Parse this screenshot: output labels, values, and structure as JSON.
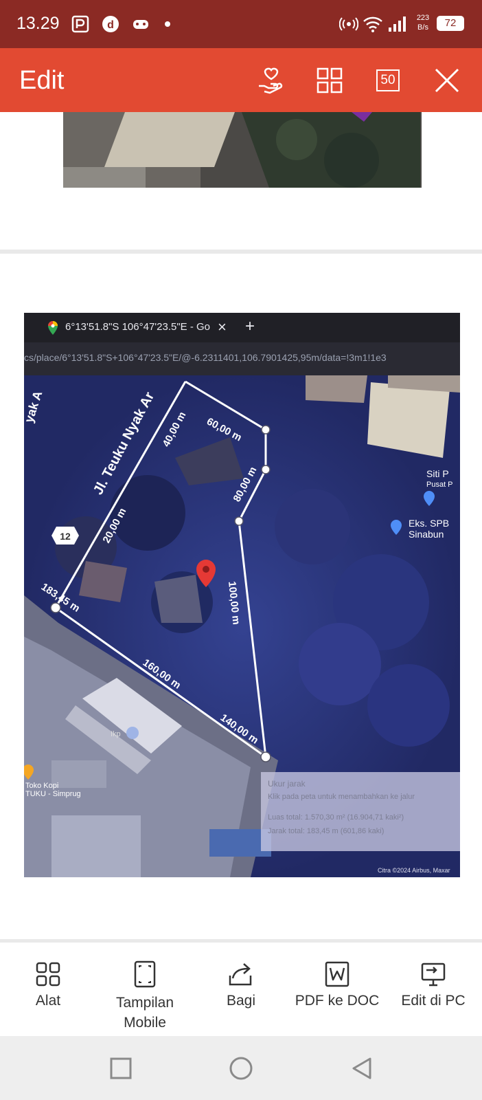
{
  "status_bar": {
    "time": "13.29",
    "network_speed_value": "223",
    "network_speed_unit": "B/s",
    "battery": "72"
  },
  "toolbar": {
    "title": "Edit",
    "page_count_badge": "50",
    "icons": [
      "donate-hand-heart-icon",
      "grid-view-icon",
      "page-count-icon",
      "close-icon"
    ]
  },
  "browser": {
    "tab_title": "6°13'51.8\"S 106°47'23.5\"E - Go",
    "tab_close": "×",
    "new_tab": "+",
    "url": "cs/place/6°13'51.8\"S+106°47'23.5\"E/@-6.2311401,106.7901425,95m/data=!3m1!1e3"
  },
  "map": {
    "street_label": "Jl. Teuku Nyak Ar",
    "street_label_top": "yak A",
    "route_badge": "12",
    "segment_labels": [
      "60,00 m",
      "40,00 m",
      "80,00 m",
      "20,00 m",
      "100,00 m",
      "183,45 m",
      "160,00 m",
      "140,00 m"
    ],
    "places": [
      {
        "name_line1": "Siti P",
        "name_line2": "Pusat P"
      },
      {
        "name_line1": "Eks. SPB",
        "name_line2": "Sinabun"
      },
      {
        "name_line1": "Toko Kopi",
        "name_line2": "TUKU - Simprug"
      }
    ],
    "poi_short": "Ikp",
    "measure_panel": {
      "title": "Ukur jarak",
      "hint": "Klik pada peta untuk menambahkan ke jalur",
      "area": "Luas total: 1.570,30 m² (16.904,71 kaki²)",
      "distance": "Jarak total: 183,45 m (601,86 kaki)"
    },
    "attribution": "Citra ©2024 Airbus, Maxar"
  },
  "bottom_nav": [
    {
      "label": "Alat",
      "icon": "tools-grid-icon"
    },
    {
      "label": "Tampilan Mobile",
      "icon": "mobile-view-icon"
    },
    {
      "label": "Bagi",
      "icon": "share-icon"
    },
    {
      "label": "PDF ke DOC",
      "icon": "word-doc-icon"
    },
    {
      "label": "Edit di PC",
      "icon": "desktop-icon"
    }
  ],
  "system_nav": [
    "recent-apps-icon",
    "home-icon",
    "back-icon"
  ],
  "colors": {
    "status_bar": "#8b2a24",
    "toolbar": "#e24a32",
    "map_pin": "#e53935"
  }
}
